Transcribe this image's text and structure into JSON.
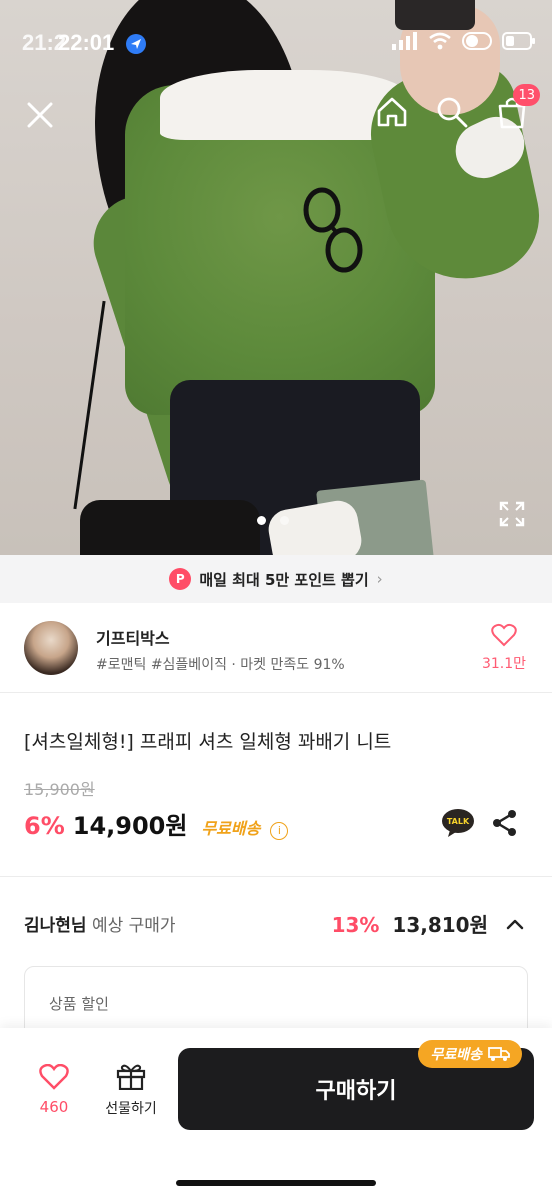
{
  "status_bar": {
    "time": "22:01",
    "time_ghost": "21:2"
  },
  "nav": {
    "cart_count": "13"
  },
  "promo": {
    "icon_letter": "P",
    "text": "매일 최대 5만 포인트 뽑기"
  },
  "store": {
    "name": "기프티박스",
    "tags": "#로맨틱 #심플베이직 · 마켓 만족도 91%",
    "like_count": "31.1만"
  },
  "product": {
    "title": "[셔츠일체형!] 프래피 셔츠 일체형 꽈배기 니트",
    "original_price": "15,900원",
    "discount_rate": "6%",
    "price": "14,900원",
    "shipping": "무료배송",
    "info_icon": "i"
  },
  "expected_price": {
    "user": "김나현님",
    "label": "예상 구매가",
    "discount_rate": "13%",
    "price": "13,810원"
  },
  "discount_box": {
    "label": "상품 할인"
  },
  "bottom_bar": {
    "wish_count": "460",
    "gift_label": "선물하기",
    "buy_label": "구매하기",
    "buy_badge": "무료배송"
  },
  "colors": {
    "accent": "#ff4d67",
    "shipping": "#f0a21a",
    "buy_button": "#1c1c1e",
    "sweater": "#5d8a3b"
  }
}
